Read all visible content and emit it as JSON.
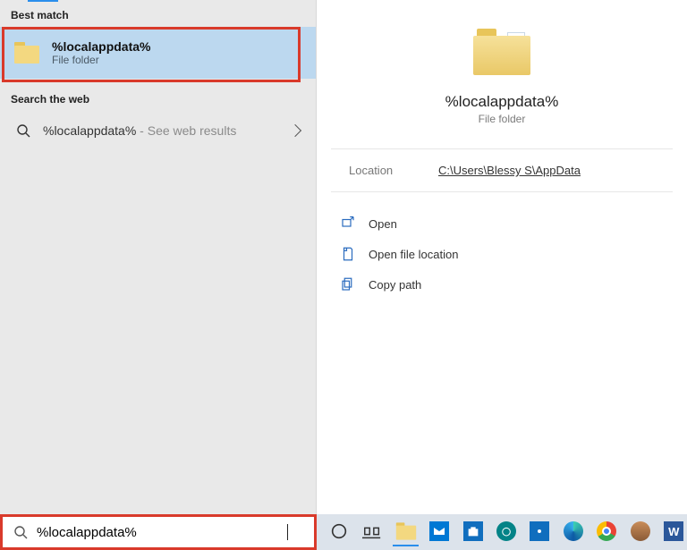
{
  "sections": {
    "best_match_label": "Best match",
    "search_web_label": "Search the web"
  },
  "best_match": {
    "title": "%localappdata%",
    "subtitle": "File folder"
  },
  "web_result": {
    "prefix": "%localappdata%",
    "suffix": " - See web results"
  },
  "details": {
    "title": "%localappdata%",
    "subtitle": "File folder",
    "location_label": "Location",
    "location_path": "C:\\Users\\Blessy S\\AppData"
  },
  "actions": {
    "open": "Open",
    "open_location": "Open file location",
    "copy_path": "Copy path"
  },
  "search_box": {
    "value": "%localappdata%"
  },
  "taskbar": {
    "word_glyph": "W"
  }
}
